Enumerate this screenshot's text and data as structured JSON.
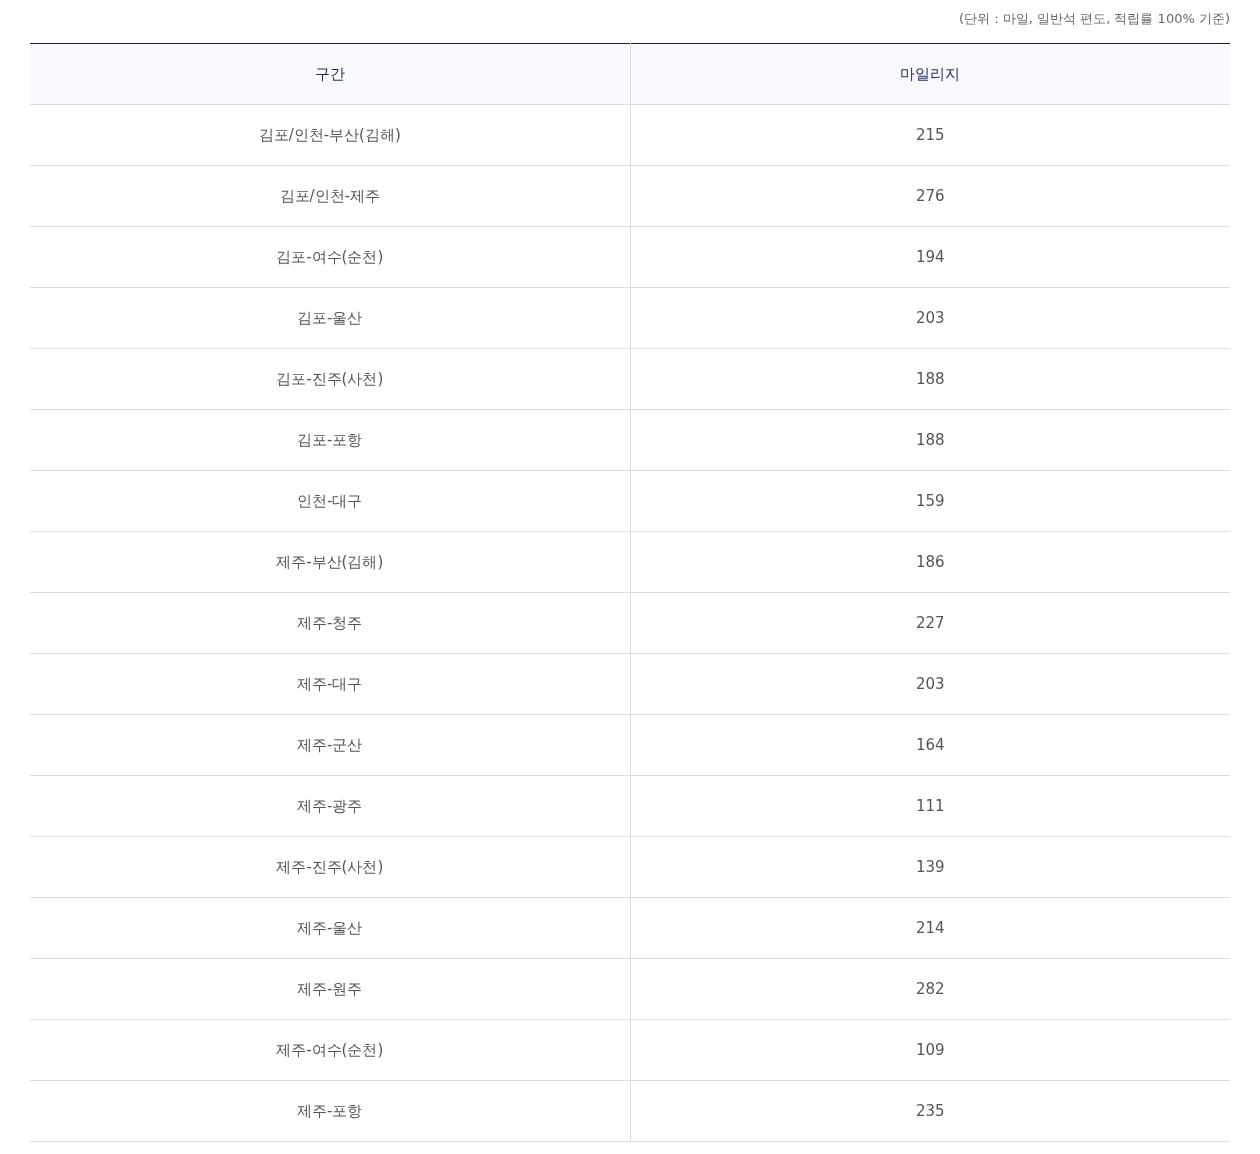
{
  "unit_note": "(단위 : 마일, 일반석 편도, 적립률 100% 기준)",
  "table": {
    "columns": [
      "구간",
      "마일리지"
    ],
    "rows": [
      [
        "김포/인천-부산(김해)",
        "215"
      ],
      [
        "김포/인천-제주",
        "276"
      ],
      [
        "김포-여수(순천)",
        "194"
      ],
      [
        "김포-울산",
        "203"
      ],
      [
        "김포-진주(사천)",
        "188"
      ],
      [
        "김포-포항",
        "188"
      ],
      [
        "인천-대구",
        "159"
      ],
      [
        "제주-부산(김해)",
        "186"
      ],
      [
        "제주-청주",
        "227"
      ],
      [
        "제주-대구",
        "203"
      ],
      [
        "제주-군산",
        "164"
      ],
      [
        "제주-광주",
        "111"
      ],
      [
        "제주-진주(사천)",
        "139"
      ],
      [
        "제주-울산",
        "214"
      ],
      [
        "제주-원주",
        "282"
      ],
      [
        "제주-여수(순천)",
        "109"
      ],
      [
        "제주-포항",
        "235"
      ]
    ]
  }
}
